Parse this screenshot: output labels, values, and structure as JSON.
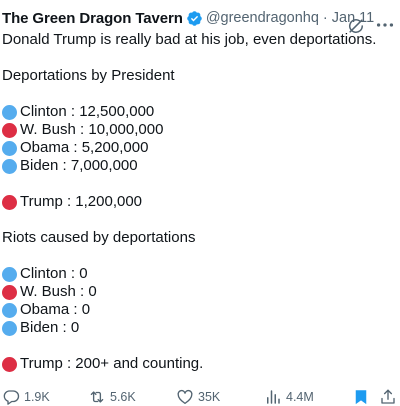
{
  "tweet": {
    "author": "The Green Dragon Tavern",
    "handle": "@greendragonhq",
    "separator": "·",
    "date": "Jan 11",
    "intro": "Donald Trump is really bad at his job, even deportations.",
    "section1_title": "Deportations by President",
    "deportations": [
      {
        "text": "Clinton : 12,500,000",
        "color": "#55acee"
      },
      {
        "text": "W. Bush : 10,000,000",
        "color": "#dd2e44"
      },
      {
        "text": "Obama : 5,200,000",
        "color": "#55acee"
      },
      {
        "text": "Biden : 7,000,000",
        "color": "#55acee"
      }
    ],
    "deportations_trump": {
      "text": "Trump : 1,200,000",
      "color": "#dd2e44"
    },
    "section2_title": "Riots caused by deportations",
    "riots": [
      {
        "text": "Clinton : 0",
        "color": "#55acee"
      },
      {
        "text": "W. Bush : 0",
        "color": "#dd2e44"
      },
      {
        "text": "Obama : 0",
        "color": "#55acee"
      },
      {
        "text": "Biden : 0",
        "color": "#55acee"
      }
    ],
    "riots_trump": {
      "text": "Trump : 200+ and counting.",
      "color": "#dd2e44"
    }
  },
  "actions": {
    "replies": "1.9K",
    "reposts": "5.6K",
    "likes": "35K",
    "views": "4.4M"
  },
  "colors": {
    "verified": "#1d9bf0",
    "bookmark": "#1d9bf0",
    "muted": "#536471"
  },
  "icons": [
    "verified-badge-icon",
    "grok-icon",
    "more-icon",
    "reply-icon",
    "repost-icon",
    "like-icon",
    "views-icon",
    "bookmark-icon",
    "share-icon"
  ]
}
